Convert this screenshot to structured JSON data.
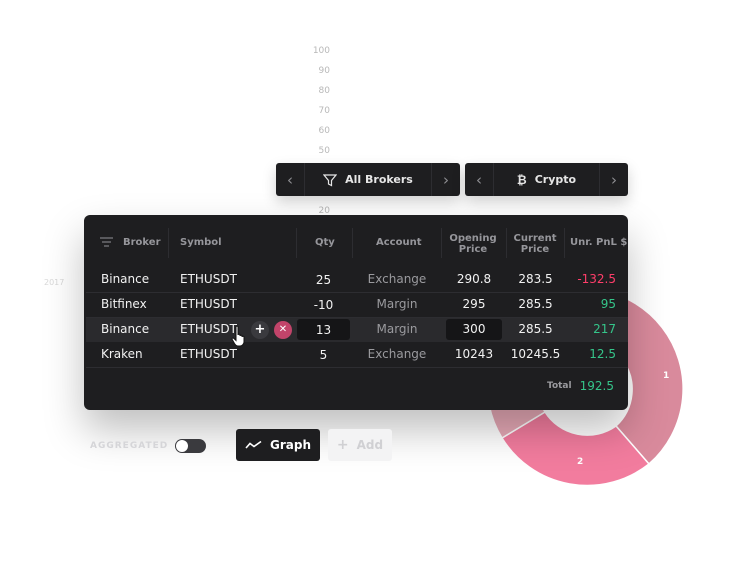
{
  "colors": {
    "panel": "#1e1e20",
    "positive": "#35c58a",
    "negative": "#ff3e6a",
    "donut_light": "#d98a9c",
    "donut_pink": "#f27c9e"
  },
  "axis": {
    "y_labels": [
      "100",
      "90",
      "80",
      "70",
      "60",
      "50",
      "20"
    ],
    "left_label": "2017"
  },
  "filters": {
    "broker": {
      "label": "All Brokers",
      "icon": "filter-icon"
    },
    "asset": {
      "label": "Crypto",
      "icon": "bitcoin-icon"
    }
  },
  "table": {
    "headers": {
      "broker": "Broker",
      "symbol": "Symbol",
      "qty": "Qty",
      "account": "Account",
      "opening1": "Opening",
      "opening2": "Price",
      "current1": "Current",
      "current2": "Price",
      "pnl": "Unr. PnL $"
    },
    "rows": [
      {
        "broker": "Binance",
        "symbol": "ETHUSDT",
        "qty": "25",
        "account": "Exchange",
        "opening": "290.8",
        "current": "283.5",
        "pnl": "-132.5"
      },
      {
        "broker": "Bitfinex",
        "symbol": "ETHUSDT",
        "qty": "-10",
        "account": "Margin",
        "opening": "295",
        "current": "285.5",
        "pnl": "95"
      },
      {
        "broker": "Binance",
        "symbol": "ETHUSDT",
        "qty": "13",
        "account": "Margin",
        "opening": "300",
        "current": "285.5",
        "pnl": "217"
      },
      {
        "broker": "Kraken",
        "symbol": "ETHUSDT",
        "qty": "5",
        "account": "Exchange",
        "opening": "10243",
        "current": "10245.5",
        "pnl": "12.5"
      }
    ],
    "total_label": "Total",
    "total_value": "192.5"
  },
  "donut": {
    "label1": "1",
    "label2": "2"
  },
  "controls": {
    "aggregated_label": "AGGREGATED",
    "aggregated_on": false,
    "graph_label": "Graph",
    "add_label": "Add"
  }
}
